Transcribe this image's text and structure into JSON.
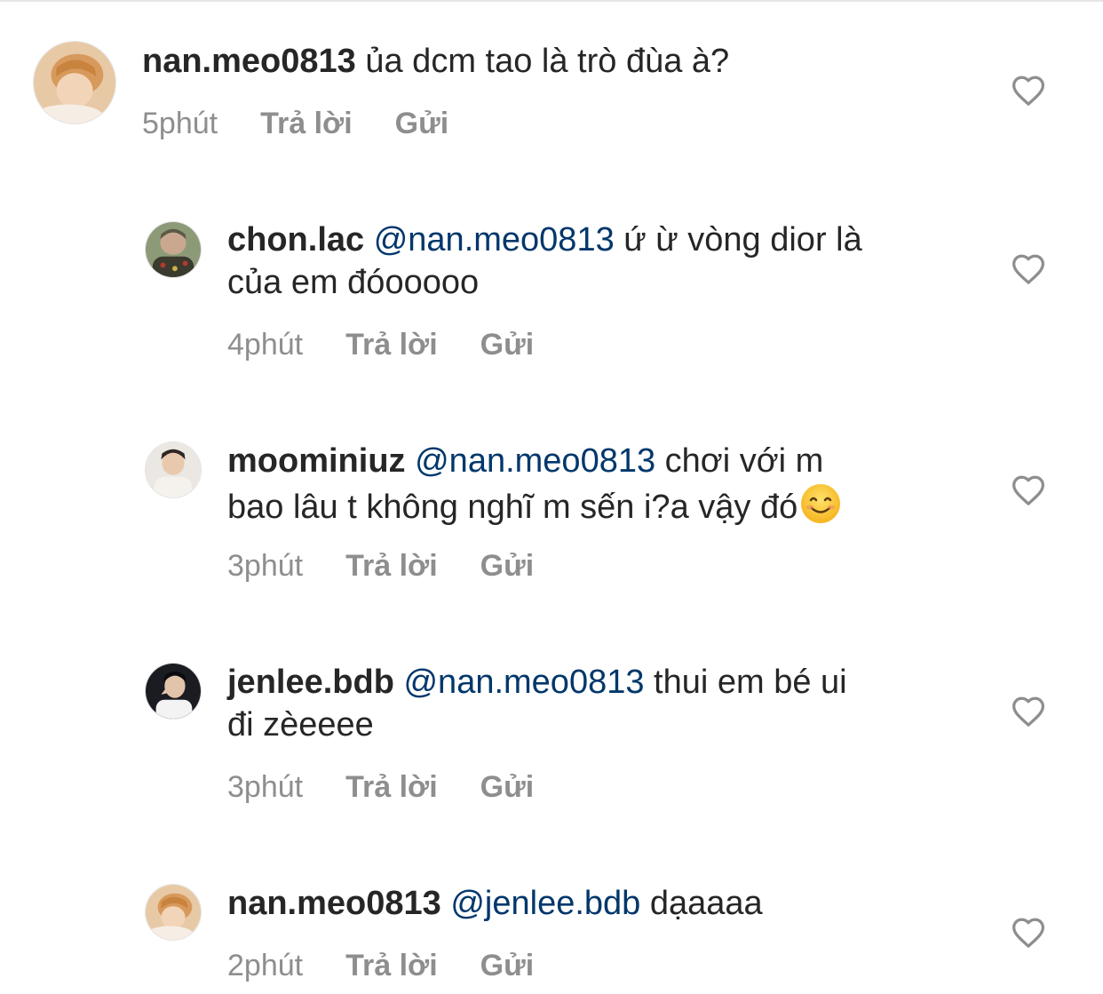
{
  "comments": [
    {
      "username": "nan.meo0813",
      "mention": "",
      "text": "ủa dcm tao là trò đùa à?",
      "time": "5phút",
      "reply_label": "Trả lời",
      "send_label": "Gửi"
    },
    {
      "username": "chon.lac",
      "mention": "@nan.meo0813",
      "text": "ứ ừ vòng dior là",
      "text_line2": "của em đóooooo",
      "time": "4phút",
      "reply_label": "Trả lời",
      "send_label": "Gửi"
    },
    {
      "username": "moominiuz",
      "mention": "@nan.meo0813",
      "text": "chơi với m",
      "text_line2": "bao lâu t không nghĩ m sến i?a vậy đó",
      "emoji": "smiling-face-emoji",
      "time": "3phút",
      "reply_label": "Trả lời",
      "send_label": "Gửi"
    },
    {
      "username": "jenlee.bdb",
      "mention": "@nan.meo0813",
      "text": "thui em bé ui",
      "text_line2": "đi zèeeee",
      "time": "3phút",
      "reply_label": "Trả lời",
      "send_label": "Gửi"
    },
    {
      "username": "nan.meo0813",
      "mention": "@jenlee.bdb",
      "text": "dạaaaa",
      "time": "2phút",
      "reply_label": "Trả lời",
      "send_label": "Gửi"
    }
  ],
  "icons": {
    "like": "heart-outline-icon"
  },
  "colors": {
    "text": "#262626",
    "mention": "#00376b",
    "meta": "#8e8e8e",
    "divider": "#e6e6e6"
  }
}
